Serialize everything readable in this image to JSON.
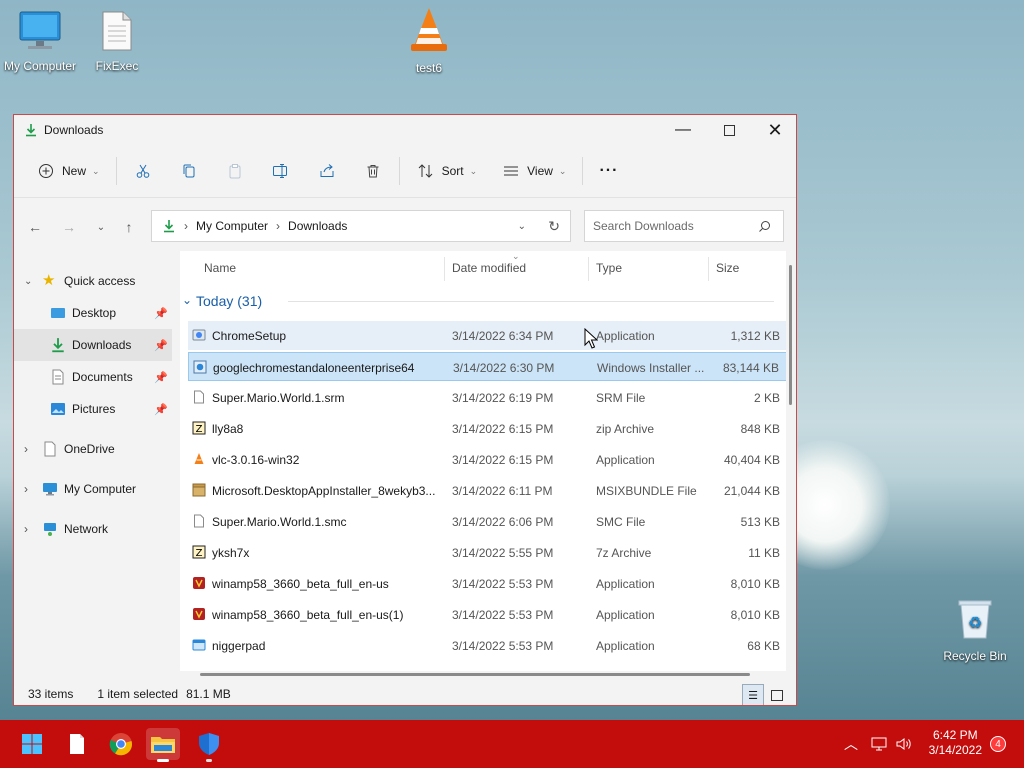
{
  "desktop": {
    "icons": [
      {
        "label": "My Computer",
        "icon": "monitor-icon"
      },
      {
        "label": "FixExec",
        "icon": "document-icon"
      },
      {
        "label": "test6",
        "icon": "vlc-cone-icon"
      },
      {
        "label": "Recycle Bin",
        "icon": "recycle-bin-icon"
      }
    ]
  },
  "window": {
    "title": "Downloads",
    "toolbar": {
      "new_label": "New",
      "sort_label": "Sort",
      "view_label": "View",
      "more_label": "···"
    },
    "address": {
      "crumb1": "My Computer",
      "crumb2": "Downloads",
      "search_placeholder": "Search Downloads"
    },
    "sidebar": {
      "items": [
        {
          "label": "Quick access"
        },
        {
          "label": "Desktop"
        },
        {
          "label": "Downloads"
        },
        {
          "label": "Documents"
        },
        {
          "label": "Pictures"
        },
        {
          "label": "OneDrive"
        },
        {
          "label": "My Computer"
        },
        {
          "label": "Network"
        }
      ]
    },
    "columns": {
      "name": "Name",
      "date": "Date modified",
      "type": "Type",
      "size": "Size"
    },
    "group_label": "Today (31)",
    "files": [
      {
        "name": "ChromeSetup",
        "date": "3/14/2022 6:34 PM",
        "type": "Application",
        "size": "1,312 KB"
      },
      {
        "name": "googlechromestandaloneenterprise64",
        "date": "3/14/2022 6:30 PM",
        "type": "Windows Installer ...",
        "size": "83,144 KB"
      },
      {
        "name": "Super.Mario.World.1.srm",
        "date": "3/14/2022 6:19 PM",
        "type": "SRM File",
        "size": "2 KB"
      },
      {
        "name": "lly8a8",
        "date": "3/14/2022 6:15 PM",
        "type": "zip Archive",
        "size": "848 KB"
      },
      {
        "name": "vlc-3.0.16-win32",
        "date": "3/14/2022 6:15 PM",
        "type": "Application",
        "size": "40,404 KB"
      },
      {
        "name": "Microsoft.DesktopAppInstaller_8wekyb3...",
        "date": "3/14/2022 6:11 PM",
        "type": "MSIXBUNDLE File",
        "size": "21,044 KB"
      },
      {
        "name": "Super.Mario.World.1.smc",
        "date": "3/14/2022 6:06 PM",
        "type": "SMC File",
        "size": "513 KB"
      },
      {
        "name": "yksh7x",
        "date": "3/14/2022 5:55 PM",
        "type": "7z Archive",
        "size": "11 KB"
      },
      {
        "name": "winamp58_3660_beta_full_en-us",
        "date": "3/14/2022 5:53 PM",
        "type": "Application",
        "size": "8,010 KB"
      },
      {
        "name": "winamp58_3660_beta_full_en-us(1)",
        "date": "3/14/2022 5:53 PM",
        "type": "Application",
        "size": "8,010 KB"
      },
      {
        "name": "niggerpad",
        "date": "3/14/2022 5:53 PM",
        "type": "Application",
        "size": "68 KB"
      }
    ],
    "status": {
      "items": "33 items",
      "selected": "1 item selected",
      "size": "81.1 MB"
    }
  },
  "taskbar": {
    "time": "6:42 PM",
    "date": "3/14/2022",
    "notification_count": "4"
  },
  "colors": {
    "taskbar": "#c30d0d",
    "selection": "#cce4f7",
    "accent": "#0067c0"
  }
}
